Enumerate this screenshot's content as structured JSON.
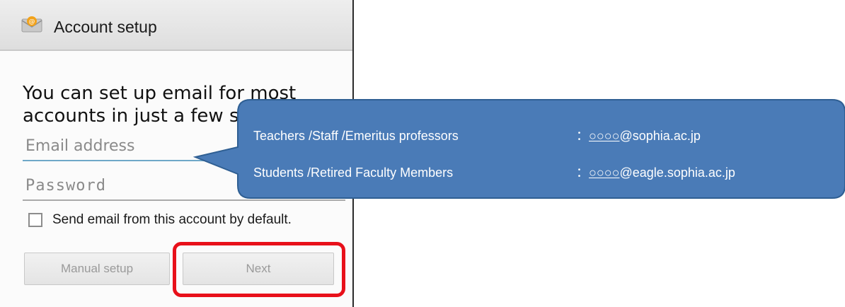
{
  "topbar": {
    "title": "Account setup",
    "icon": "email-app-icon"
  },
  "heading": {
    "line1": "You can set up email for most",
    "line2": "accounts in just a few steps."
  },
  "fields": {
    "email_placeholder": "Email address",
    "password_placeholder": "Password"
  },
  "default_checkbox": {
    "label": "Send email from this account by default.",
    "checked": false
  },
  "buttons": {
    "manual_label": "Manual setup",
    "next_label": "Next"
  },
  "callout": {
    "rows": [
      {
        "who": "Teachers /Staff /Emeritus professors",
        "separator": "：",
        "placeholder": "○○○○",
        "domain": "@sophia.ac.jp"
      },
      {
        "who": "Students /Retired Faculty Members",
        "separator": "：",
        "placeholder": "○○○○",
        "domain": "@eagle.sophia.ac.jp"
      }
    ],
    "fill_color": "#4a7bb7",
    "border_color": "#2f5f93"
  },
  "highlight_color": "#e8101a"
}
